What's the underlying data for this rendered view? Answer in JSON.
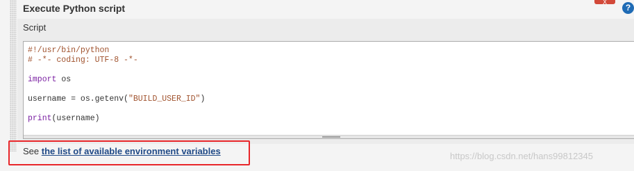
{
  "section": {
    "title": "Execute Python script",
    "delete_label": "X",
    "help_label": "?"
  },
  "script_field": {
    "label": "Script",
    "code_lines": [
      "#!/usr/bin/python",
      "# -*- coding: UTF-8 -*-",
      "",
      "import os",
      "",
      "username = os.getenv(\"BUILD_USER_ID\")",
      "",
      "print(username)"
    ]
  },
  "env_help": {
    "prefix": "See",
    "link_text": "the list of available environment variables"
  },
  "watermark": "https://blog.csdn.net/hans99812345",
  "colors": {
    "highlight_border": "#e8262a",
    "link": "#204a87",
    "delete_button": "#d24939",
    "help_icon": "#1f6bb5"
  }
}
